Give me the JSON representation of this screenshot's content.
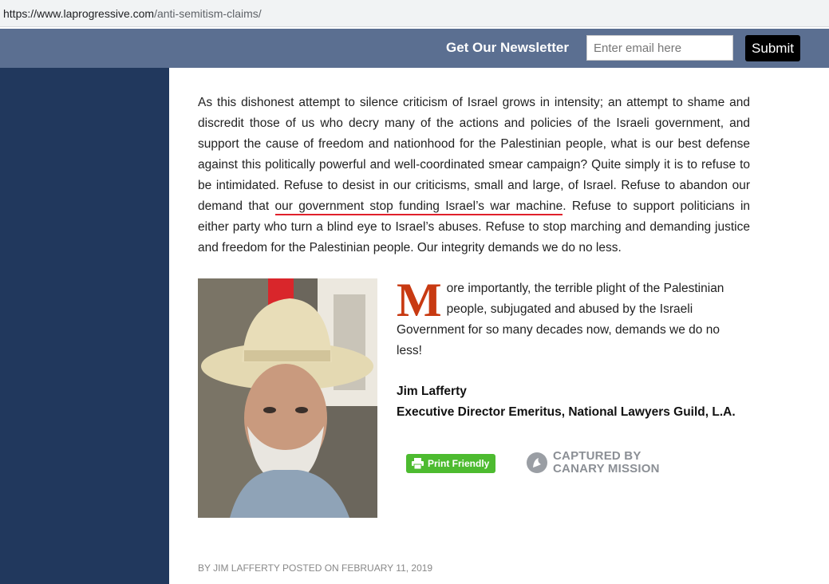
{
  "browser": {
    "url_host": "https://www.laprogressive.com",
    "url_path": "/anti-semitism-claims/"
  },
  "newsletter": {
    "label": "Get Our Newsletter",
    "email_placeholder": "Enter email here",
    "submit_label": "Submit"
  },
  "article": {
    "paragraph_1_before": "As this dishonest attempt to silence criticism of Israel grows in intensity; an attempt to shame and discredit those of us who decry many of the actions and policies of the Israeli government, and support the cause of freedom and nationhood for the Palestinian people, what is our best defense against this politically powerful and well-coordinated smear campaign? Quite simply it is to refuse to be intimidated. Refuse to desist in our criticisms, small and large, of Israel. Refuse to abandon our demand that ",
    "paragraph_1_highlight": "our government stop funding Israel’s war machine",
    "paragraph_1_after": ". Refuse to support politicians in either party who turn a blind eye to Israel’s abuses. Refuse to stop marching and demanding justice and freedom for the Palestinian people. Our integrity demands we do no less.",
    "dropcap_letter": "M",
    "paragraph_2": "ore importantly, the terrible plight of the Palestinian people, subjugated and abused by the Israeli Government for so many decades now, demands we do no less!",
    "author_name": "Jim Lafferty",
    "author_title": "Executive Director Emeritus, National Lawyers Guild, L.A.",
    "print_friendly_label": "Print Friendly",
    "canary_line_1": "CAPTURED BY",
    "canary_line_2": "CANARY MISSION",
    "byline": "BY JIM LAFFERTY POSTED ON FEBRUARY 11, 2019"
  },
  "colors": {
    "newsletter_bar": "#5b6f91",
    "sidebar": "#21385d",
    "dropcap": "#c83a12",
    "highlight_underline": "#e0202b",
    "print_button": "#4dbb30"
  },
  "icons": [
    "printer-icon",
    "canary-mission-logo-icon"
  ]
}
